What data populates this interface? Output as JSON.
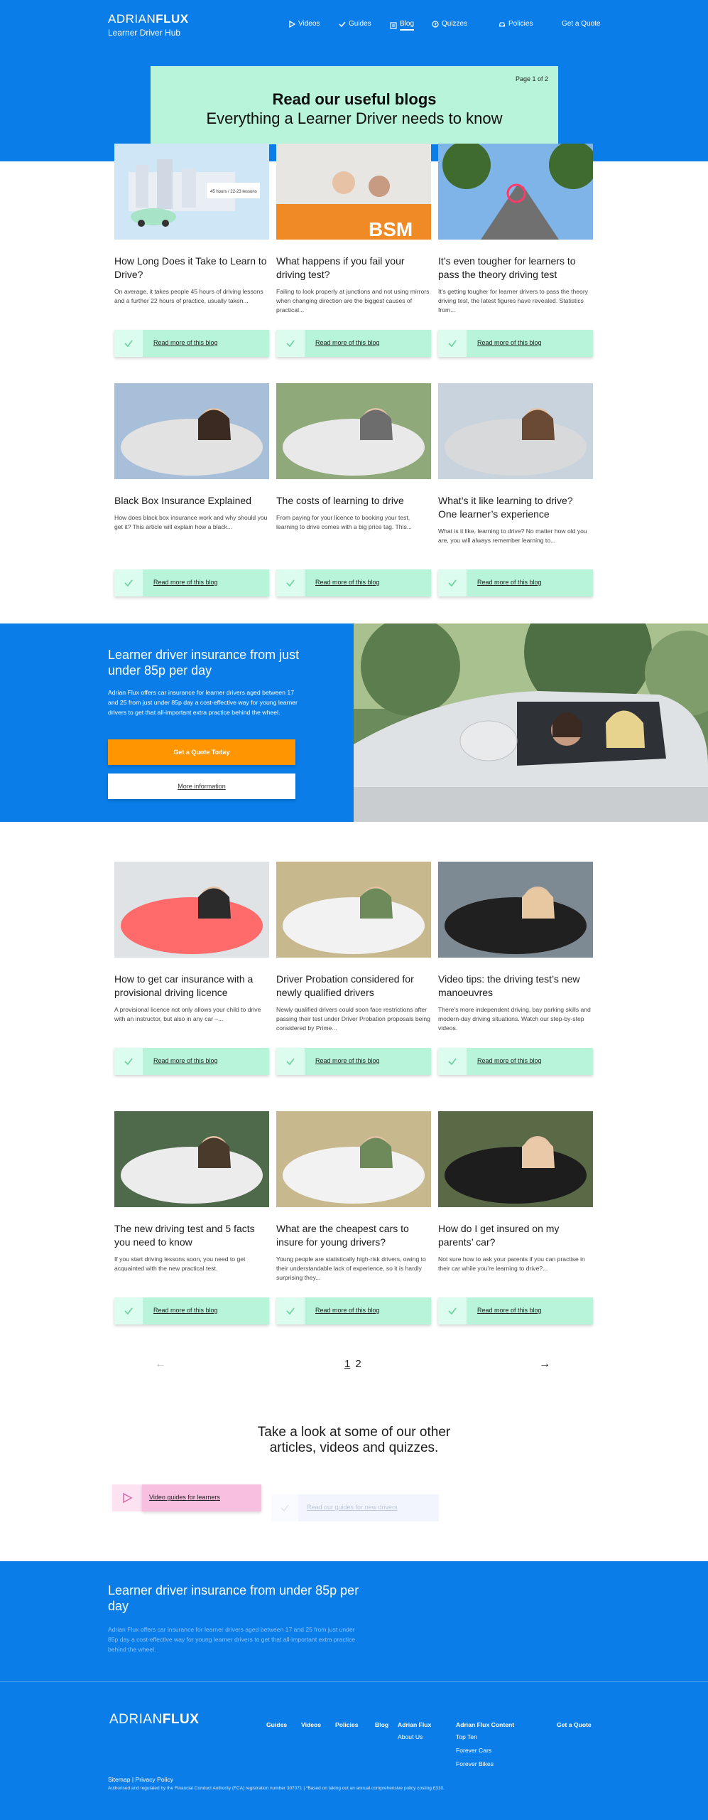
{
  "brand": {
    "logo_light": "ADRIAN",
    "logo_bold": "FLUX",
    "subtitle": "Learner Driver Hub"
  },
  "nav": [
    {
      "label": "Videos",
      "icon": "play-icon"
    },
    {
      "label": "Guides",
      "icon": "check-icon"
    },
    {
      "label": "Blog",
      "icon": "blog-icon",
      "active": true
    },
    {
      "label": "Quizzes",
      "icon": "question-icon"
    },
    {
      "label": "Policies",
      "icon": "car-icon"
    },
    {
      "label": "Get a Quote",
      "icon": ""
    }
  ],
  "header": {
    "page_indicator": "Page 1 of 2",
    "title": "Read our useful blogs",
    "subtitle": "Everything a Learner Driver needs to know"
  },
  "read_more_label": "Read more of this blog",
  "cards": [
    {
      "title": "How Long Does it Take to Learn to Drive?",
      "excerpt": "On average, it takes people 45 hours of driving lessons and a further 22 hours of practice, usually taken...",
      "image_caption": "45 hours / 22-23 lessons"
    },
    {
      "title": "What happens if you fail your driving test?",
      "excerpt": "Failing to look properly at junctions and not using mirrors when changing direction are the biggest causes of practical...",
      "image_caption": "BSM"
    },
    {
      "title": "It’s even tougher for learners to pass the theory driving test",
      "excerpt": "It’s getting tougher for learner drivers to pass the theory driving test, the latest figures have revealed. Statistics from..."
    },
    {
      "title": "Black Box Insurance Explained",
      "excerpt": "How does black box insurance work and why should you get it? This article will explain how a black..."
    },
    {
      "title": "The costs of learning to drive",
      "excerpt": "From paying for your licence to booking your test, learning to drive comes with a big price tag. This..."
    },
    {
      "title": "What’s it like learning to drive? One learner’s experience",
      "excerpt": "What is it like, learning to drive? No matter how old you are, you will always remember learning to..."
    },
    {
      "title": "How to get car insurance with a provisional driving licence",
      "excerpt": "A provisional licence not only allows your child to drive with an instructor, but also in any car –..."
    },
    {
      "title": "Driver Probation considered for newly qualified drivers",
      "excerpt": "Newly qualified drivers could soon face restrictions after passing their test under Driver Probation proposals being considered by Prime..."
    },
    {
      "title": "Video tips: the driving test’s new manoeuvres",
      "excerpt": "There’s more independent driving, bay parking skills and modern-day driving situations. Watch our step-by-step videos."
    },
    {
      "title": "The new driving test and 5 facts you need to know",
      "excerpt": "If you start driving lessons soon, you need to get acquainted with the new practical test."
    },
    {
      "title": "What are the cheapest cars to insure for young drivers?",
      "excerpt": "Young people are statistically high-risk drivers, owing to their understandable lack of experience, so it is hardly surprising they..."
    },
    {
      "title": "How do I get insured on my parents’ car?",
      "excerpt": "Not sure how to ask your parents if you can practise in their car while you’re learning to drive?..."
    }
  ],
  "promo": {
    "title": "Learner driver insurance from just under 85p per day",
    "body": "Adrian Flux offers car insurance for learner drivers aged between 17 and 25 from just under 85p day a cost-effective way for young learner drivers to get that all-important extra practice behind the wheel.",
    "cta_quote": "Get a Quote Today",
    "cta_info": "More information"
  },
  "pagination": {
    "prev_icon": "arrow-left-icon",
    "next_icon": "arrow-right-icon",
    "pages": [
      "1",
      "2"
    ],
    "current": "1"
  },
  "other": {
    "heading_line1": "Take a look at some of our other",
    "heading_line2": "articles, videos and quizzes.",
    "links": [
      {
        "label": "Video guides for learners",
        "icon": "play-icon",
        "color": "#f8bfe0"
      },
      {
        "label": "Read our guides for new drivers",
        "icon": "check-icon",
        "color": "#eef3ff"
      }
    ]
  },
  "footer_promo": {
    "title": "Learner driver insurance from under 85p per day",
    "body": "Adrian Flux offers car insurance for learner drivers aged between 17 and 25 from just under 85p day a cost-effective way for young learner drivers to get that all-important extra practice behind the wheel."
  },
  "footer": {
    "links": [
      "Guides",
      "Videos",
      "Policies",
      "Blog"
    ],
    "adrian_flux_col": {
      "heading": "Adrian Flux",
      "items": [
        "About Us"
      ]
    },
    "content_col": {
      "heading": "Adrian Flux Content",
      "items": [
        "Top Ten",
        "Forever Cars",
        "Forever Bikes"
      ]
    },
    "quote": "Get a Quote",
    "sitemap": "Sitemap",
    "privacy": "Privacy Policy",
    "legal": "Authorised and regulated by the Financial Conduct Authority (FCA) registration number 307071 | *Based on taking out an annual comprehensive policy costing £310."
  },
  "colors": {
    "primary_blue": "#0a7de8",
    "mint": "#b7f4d9",
    "orange": "#ff9500"
  }
}
